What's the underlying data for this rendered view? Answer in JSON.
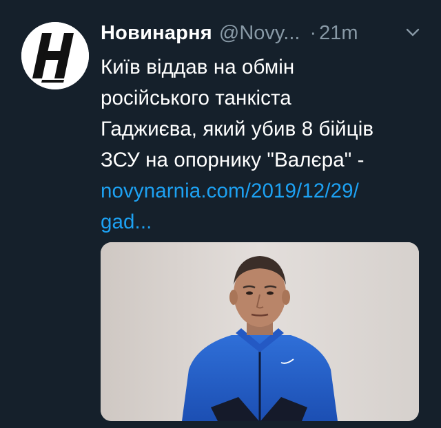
{
  "tweet": {
    "author_name": "Новинарня",
    "author_handle": "@Novy...",
    "separator": "·",
    "time": "21m",
    "text_lines": [
      "Київ віддав на обмін",
      "російського танкіста",
      "Гаджиєва, який убив 8 бійців",
      "ЗСУ на опорнику \"Валєра\" -"
    ],
    "link_lines": [
      "novynarnia.com/2019/12/29/",
      "gad..."
    ],
    "avatar_letter": "H"
  },
  "icons": {
    "more": "chevron-down-icon",
    "avatar": "novynarnia-logo"
  },
  "colors": {
    "background": "#15202b",
    "text": "#ffffff",
    "secondary": "#8899a6",
    "link": "#1da1f2"
  }
}
